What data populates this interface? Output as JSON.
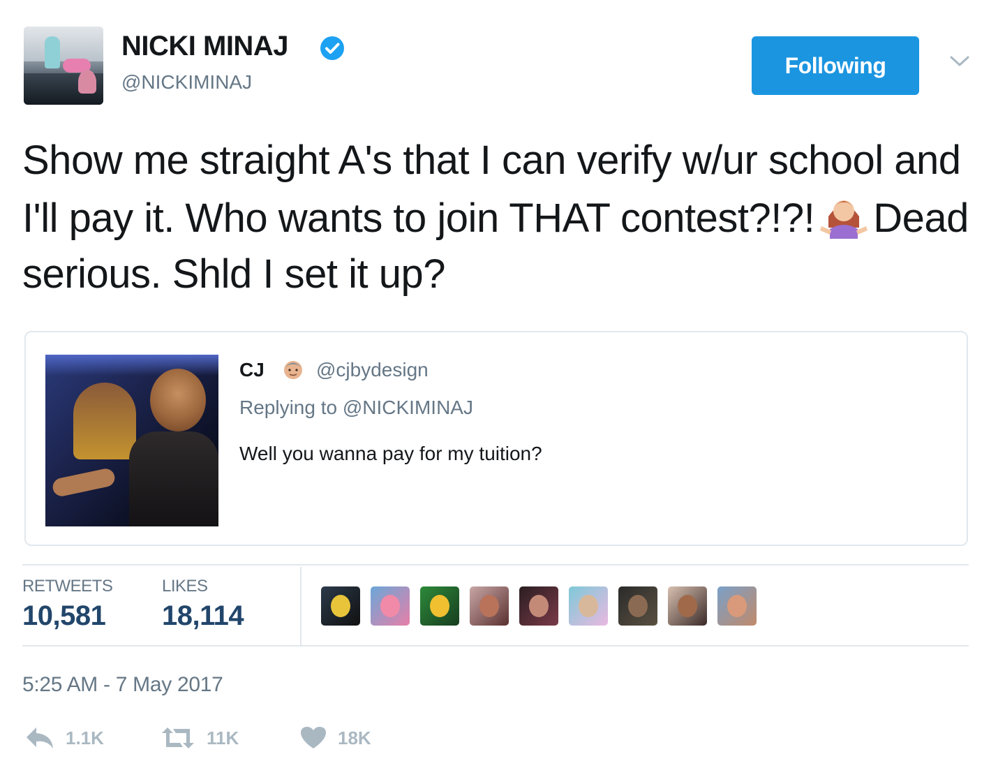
{
  "author": {
    "name": "NICKI MINAJ",
    "handle": "@NICKIMINAJ",
    "avatar_icon": "profile-photo",
    "verified_icon": "verified-badge-icon"
  },
  "follow_button": {
    "label": "Following",
    "color": "#1b95e0"
  },
  "menu_icon": "chevron-down-icon",
  "tweet": {
    "text_part1": "Show me straight A's that I can verify w/ur school and I'll pay it. Who wants to join THAT contest?!?!",
    "emoji": "person-shrugging-emoji",
    "text_part2": "Dead serious. Shld I set it up?"
  },
  "quoted_tweet": {
    "name": "CJ",
    "emoji": "man-emoji",
    "handle": "@cjbydesign",
    "replying_to": "Replying to @NICKIMINAJ",
    "text": "Well you wanna pay for my tuition?",
    "media": "quoted-gif-thumbnail"
  },
  "stats": {
    "retweets_label": "RETWEETS",
    "retweets_value": "10,581",
    "likes_label": "LIKES",
    "likes_value": "18,114",
    "value_color": "#22466b"
  },
  "likers_count_shown": 9,
  "timestamp": "5:25 AM - 7 May 2017",
  "actions": {
    "reply_count": "1.1K",
    "retweet_count": "11K",
    "like_count": "18K"
  }
}
